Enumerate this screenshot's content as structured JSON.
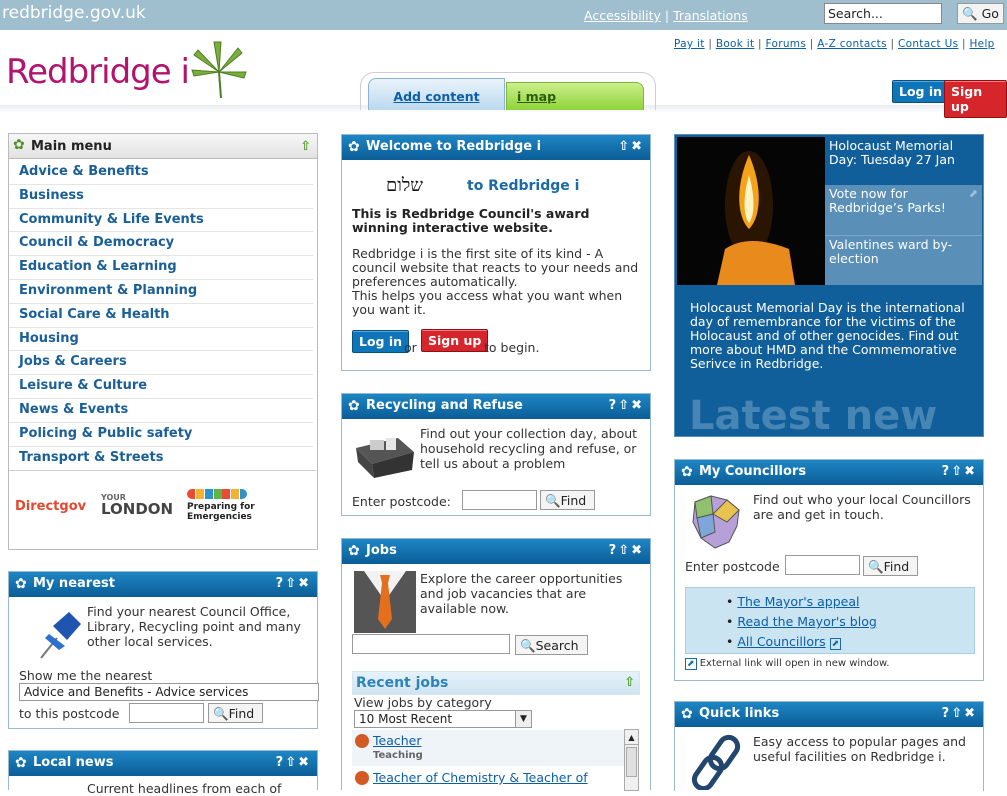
{
  "header": {
    "domain": "redbridge.gov.uk",
    "accessibility": "Accessibility",
    "translations": "Translations",
    "search_placeholder": "Search...",
    "go": "Go",
    "tool_links": [
      "Pay it",
      "Book it",
      "Forums",
      "A-Z contacts",
      "Contact Us",
      "Help"
    ],
    "logo": "Redbridge i",
    "tab_add": "Add content",
    "tab_imap": "i map",
    "login": "Log in",
    "signup": "Sign up"
  },
  "main_menu": {
    "title": "Main menu",
    "items": [
      "Advice & Benefits",
      "Business",
      "Community & Life Events",
      "Council & Democracy",
      "Education & Learning",
      "Environment & Planning",
      "Social Care & Health",
      "Housing",
      "Jobs & Careers",
      "Leisure & Culture",
      "News & Events",
      "Policing & Public safety",
      "Transport & Streets"
    ],
    "partners": [
      "Directgov",
      "YOUR",
      "LONDON",
      "Preparing for",
      "Emergencies"
    ]
  },
  "my_nearest": {
    "title": "My nearest",
    "text": "Find your nearest Council Office, Library, Recycling point and many other local services.",
    "show_label": "Show me the nearest",
    "select_value": "Advice and Benefits - Advice services",
    "postcode_label": "to this postcode",
    "find": "Find"
  },
  "local_news": {
    "title": "Local news",
    "text": "Current headlines from each of"
  },
  "welcome": {
    "title": "Welcome to Redbridge i",
    "hebrew": "שלום",
    "greeting": "to Redbridge i",
    "headline": "This is Redbridge Council's award winning interactive website.",
    "para1": "Redbridge i is the first site of its kind - A council website that reacts to your needs and preferences automatically.",
    "para2": "This helps you access what you want when you want it.",
    "login": "Log in",
    "or": "or",
    "signup": "Sign up",
    "begin": "to begin."
  },
  "recycling": {
    "title": "Recycling and Refuse",
    "text": "Find out your collection day, about household recycling and refuse, or tell us about a problem",
    "postcode_label": "Enter postcode:",
    "find": "Find"
  },
  "jobs": {
    "title": "Jobs",
    "text": "Explore the career opportunities and job vacancies that are available now.",
    "search": "Search",
    "recent_title": "Recent jobs",
    "category_label": "View jobs by category",
    "category_value": "10 Most Recent",
    "list": [
      {
        "title": "Teacher",
        "sub": "Teaching"
      },
      {
        "title": "Teacher of Chemistry & Teacher of",
        "sub": ""
      }
    ]
  },
  "feature": {
    "items": [
      "Holocaust Memorial Day: Tuesday 27 Jan",
      "Vote now for Redbridge’s Parks!",
      "Valentines ward by-election"
    ],
    "text": "Holocaust Memorial Day is the international day of remembrance for the victims of the Holocaust and of other genocides. Find out more about HMD and the Commemorative Serivce in Redbridge.",
    "watermark": "Latest new"
  },
  "councillors": {
    "title": "My Councillors",
    "text": "Find out who your local Councillors are and get in touch.",
    "postcode_label": "Enter postcode",
    "find": "Find",
    "links": [
      "The Mayor's appeal",
      "Read the Mayor's blog",
      "All Councillors"
    ],
    "external_note": "External link will open in new window."
  },
  "quick_links": {
    "title": "Quick links",
    "text": "Easy access to popular pages and useful facilities on Redbridge i."
  },
  "colors": {
    "brand": "#b2136d",
    "panel_head": "#0b5d97",
    "link": "#0b5fa8"
  }
}
